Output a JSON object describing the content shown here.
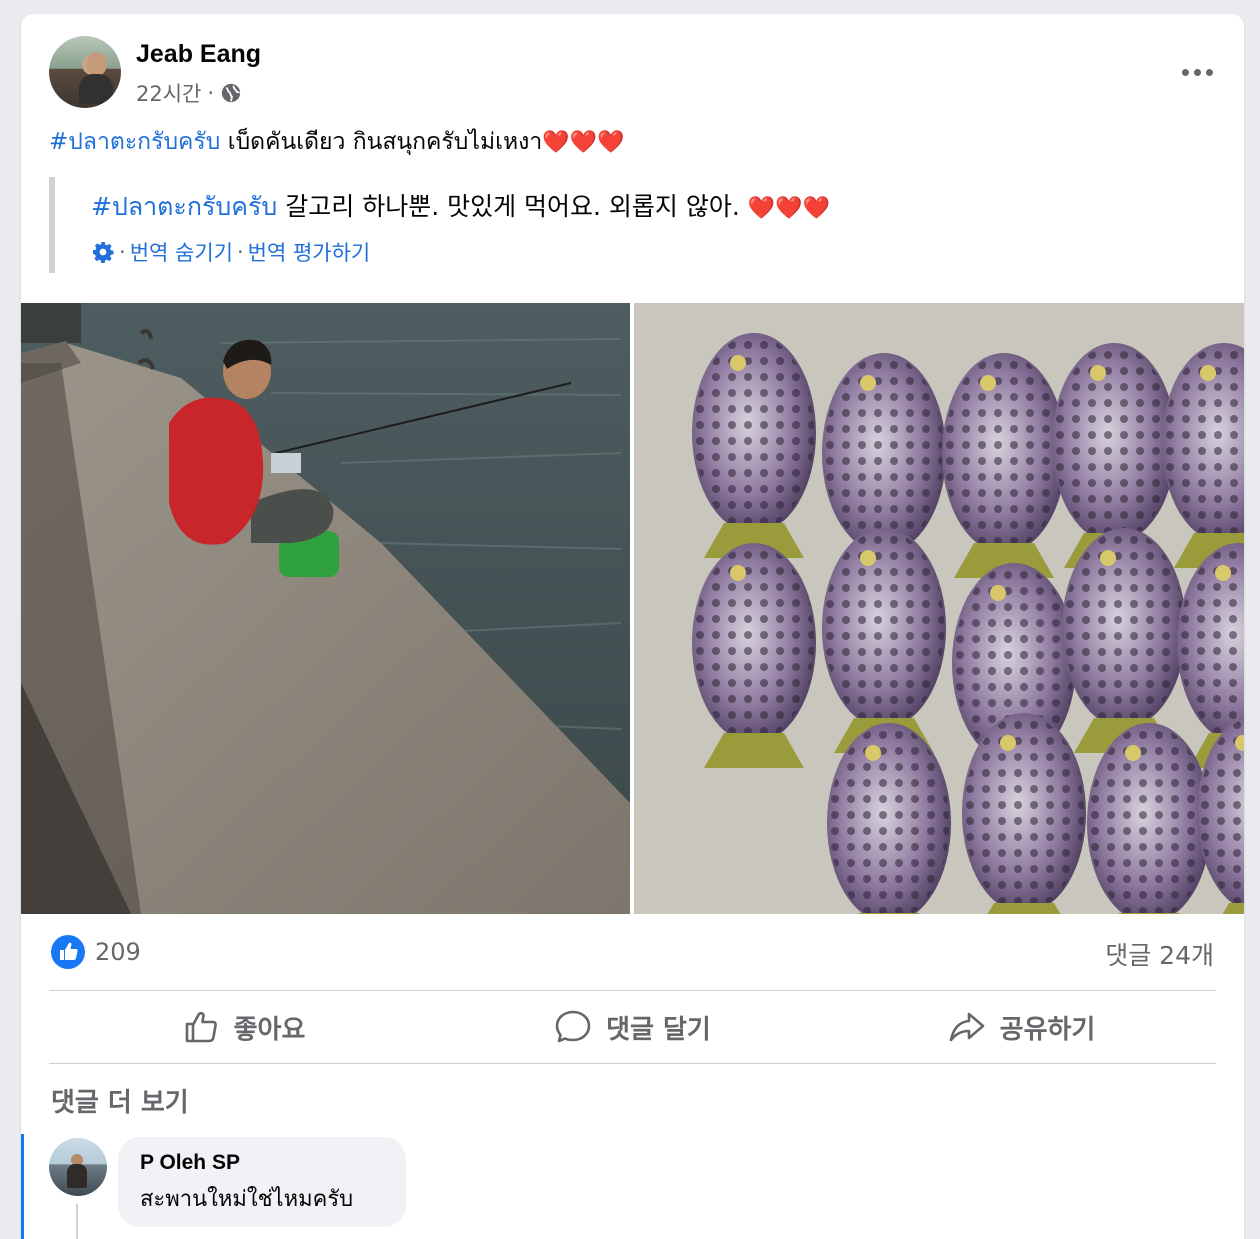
{
  "post": {
    "author": "Jeab Eang",
    "time": "22시간",
    "meta_sep": "·",
    "text_hashtag": "#ปลาตะกรับครับ",
    "text_body": " เบ็ดคันเดียว กินสนุกครับไม่เหงา",
    "hearts": "❤️❤️❤️",
    "translation": {
      "hashtag": "#ปลาตะกรับครับ",
      "body": " 갈고리 하나뿐. 맛있게 먹어요. 외롭지 않아. ",
      "hearts": "❤️❤️❤️",
      "sep": "·",
      "hide_label": "번역 숨기기",
      "rate_label": "번역 평가하기"
    }
  },
  "stats": {
    "reaction_count": "209",
    "comment_count": "댓글 24개"
  },
  "actions": {
    "like": "좋아요",
    "comment": "댓글 달기",
    "share": "공유하기"
  },
  "comments": {
    "more_label": "댓글 더 보기",
    "items": [
      {
        "name": "P Oleh SP",
        "text": "สะพานใหม่ใช่ไหมครับ"
      }
    ]
  },
  "colors": {
    "link": "#216fdb",
    "like_blue": "#1877f2",
    "secondary_text": "#65676b"
  }
}
